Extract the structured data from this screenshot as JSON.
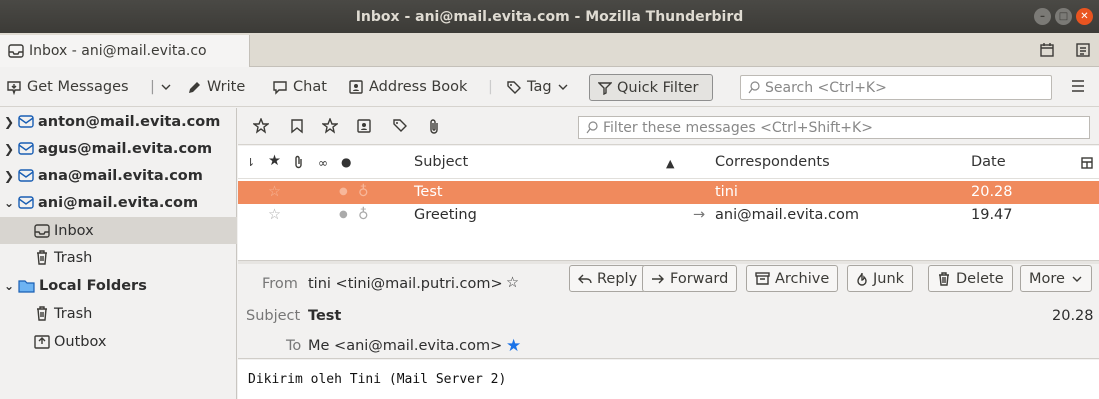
{
  "window": {
    "title": "Inbox - ani@mail.evita.com - Mozilla Thunderbird"
  },
  "tab": {
    "label": "Inbox - ani@mail.evita.co"
  },
  "toolbar": {
    "get_messages": "Get Messages",
    "write": "Write",
    "chat": "Chat",
    "address_book": "Address Book",
    "tag": "Tag",
    "quick_filter": "Quick Filter",
    "search_placeholder": "Search <Ctrl+K>"
  },
  "folders": [
    {
      "label": "anton@mail.evita.com",
      "expanded": false
    },
    {
      "label": "agus@mail.evita.com",
      "expanded": false
    },
    {
      "label": "ana@mail.evita.com",
      "expanded": false
    },
    {
      "label": "ani@mail.evita.com",
      "expanded": true
    },
    {
      "label": "Inbox"
    },
    {
      "label": "Trash"
    },
    {
      "label": "Local Folders",
      "expanded": true
    },
    {
      "label": "Trash"
    },
    {
      "label": "Outbox"
    }
  ],
  "filterbar": {
    "placeholder": "Filter these messages <Ctrl+Shift+K>"
  },
  "columns": {
    "subject": "Subject",
    "correspondents": "Correspondents",
    "date": "Date"
  },
  "messages": [
    {
      "subject": "Test",
      "correspondent": "tini",
      "date": "20.28",
      "selected": true
    },
    {
      "subject": "Greeting",
      "correspondent": "ani@mail.evita.com",
      "date": "19.47",
      "selected": false
    }
  ],
  "header": {
    "from_label": "From",
    "from_value": "tini <tini@mail.putri.com>",
    "subject_label": "Subject",
    "subject_value": "Test",
    "date": "20.28",
    "to_label": "To",
    "to_value": "Me <ani@mail.evita.com>",
    "reply": "Reply",
    "forward": "Forward",
    "archive": "Archive",
    "junk": "Junk",
    "delete": "Delete",
    "more": "More"
  },
  "body": {
    "text": "Dikirim oleh Tini (Mail Server 2)"
  },
  "colors": {
    "selection": "#f08a5d",
    "accent": "#e95420",
    "star": "#1a73e8"
  }
}
